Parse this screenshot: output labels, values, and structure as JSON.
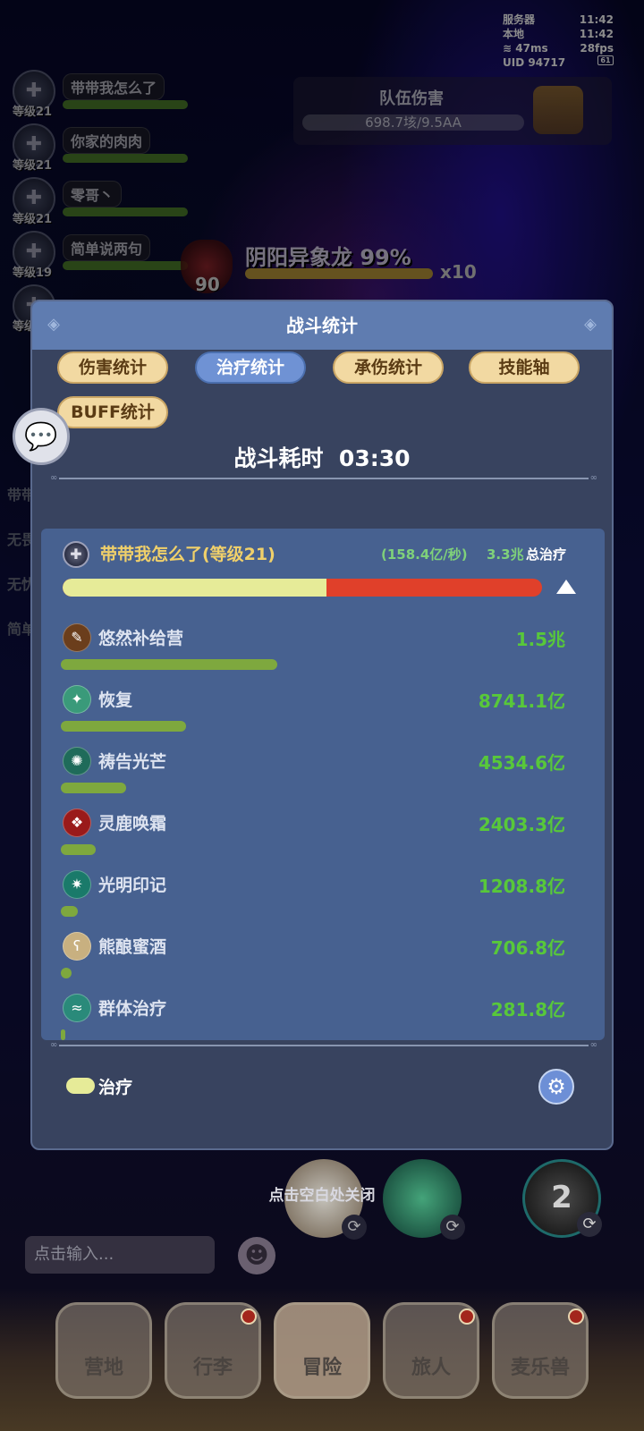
{
  "status": {
    "server_label": "服务器",
    "server_time": "11:42",
    "local_label": "本地",
    "local_time": "11:42",
    "ping": "47ms",
    "fps": "28fps",
    "uid_label": "UID",
    "uid": "94717",
    "battery": "61"
  },
  "party": [
    {
      "name": "带带我怎么了",
      "level": "等级21"
    },
    {
      "name": "你家的肉肉",
      "level": "等级21"
    },
    {
      "name": "零哥丶",
      "level": "等级21"
    },
    {
      "name": "简单说两句",
      "level": "等级19"
    },
    {
      "name": "",
      "level": "等级"
    }
  ],
  "team_damage": {
    "title": "队伍伤害",
    "value": "698.7垓/9.5AA"
  },
  "boss": {
    "level": "90",
    "name": "阴阳异象龙",
    "hp_percent": "99%",
    "multiplier": "x10"
  },
  "side_list": [
    "带带",
    "无畏",
    "无忧",
    "简单"
  ],
  "dialog": {
    "title": "战斗统计",
    "tabs": [
      {
        "label": "伤害统计",
        "active": false
      },
      {
        "label": "治疗统计",
        "active": true
      },
      {
        "label": "承伤统计",
        "active": false
      },
      {
        "label": "技能轴",
        "active": false
      },
      {
        "label": "BUFF统计",
        "active": false
      }
    ],
    "duration_label": "战斗耗时",
    "duration_value": "03:30",
    "player": {
      "name": "带带我怎么了(等级21)",
      "rate": "(158.4亿/秒)",
      "total": "3.3兆",
      "total_label": "总治疗",
      "bar_fraction": 0.55
    },
    "skills": [
      {
        "name": "悠然补给营",
        "value": "1.5兆",
        "fraction": 1.0,
        "icon": "bread-icon",
        "color": "#6b3e1c"
      },
      {
        "name": "恢复",
        "value": "8741.1亿",
        "fraction": 0.58,
        "icon": "restore-icon",
        "color": "#3a9a7a"
      },
      {
        "name": "祷告光芒",
        "value": "4534.6亿",
        "fraction": 0.3,
        "icon": "prayer-light-icon",
        "color": "#1f6b5a"
      },
      {
        "name": "灵鹿唤霜",
        "value": "2403.3亿",
        "fraction": 0.16,
        "icon": "deer-frost-icon",
        "color": "#9a1a1a"
      },
      {
        "name": "光明印记",
        "value": "1208.8亿",
        "fraction": 0.08,
        "icon": "light-mark-icon",
        "color": "#1a7a6a"
      },
      {
        "name": "熊酿蜜酒",
        "value": "706.8亿",
        "fraction": 0.05,
        "icon": "bear-mead-icon",
        "color": "#c8b080"
      },
      {
        "name": "群体治疗",
        "value": "281.8亿",
        "fraction": 0.02,
        "icon": "group-heal-icon",
        "color": "#2a8a7a"
      }
    ],
    "legend_label": "治疗"
  },
  "close_hint": "点击空白处关闭",
  "chat_placeholder": "点击输入...",
  "skill_orb_count": "2",
  "nav": [
    {
      "label": "营地",
      "badge": false
    },
    {
      "label": "行李",
      "badge": true
    },
    {
      "label": "冒险",
      "badge": false,
      "active": true
    },
    {
      "label": "旅人",
      "badge": true
    },
    {
      "label": "麦乐兽",
      "badge": true
    }
  ]
}
